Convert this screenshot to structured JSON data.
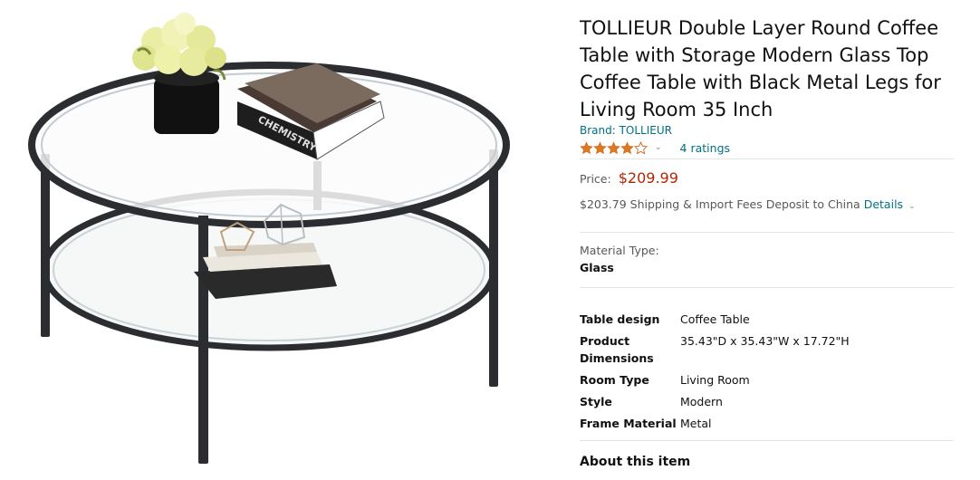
{
  "product": {
    "title": "TOLLIEUR Double Layer Round Coffee Table with Storage Modern Glass Top Coffee Table with Black Metal Legs for Living Room 35 Inch",
    "brand_text": "Brand: TOLLIEUR",
    "rating": {
      "stars": 4,
      "ratings_text": "4 ratings"
    },
    "price": {
      "label": "Price:",
      "value": "$209.99"
    },
    "shipping": {
      "text": "$203.79 Shipping & Import Fees Deposit to China",
      "details_link": "Details"
    },
    "material": {
      "label": "Material Type:",
      "value": "Glass"
    },
    "specs": [
      {
        "key": "Table design",
        "value": "Coffee Table"
      },
      {
        "key": "Product Dimensions",
        "value": "35.43\"D x 35.43\"W x 17.72\"H"
      },
      {
        "key": "Room Type",
        "value": "Living Room"
      },
      {
        "key": "Style",
        "value": "Modern"
      },
      {
        "key": "Frame Material",
        "value": "Metal"
      }
    ],
    "about_heading": "About this item"
  },
  "book_spine_text": "CHEMISTRY",
  "colors": {
    "link": "#007185",
    "price": "#b12704",
    "star": "#de7921",
    "text": "#0f1111",
    "muted": "#565959"
  }
}
